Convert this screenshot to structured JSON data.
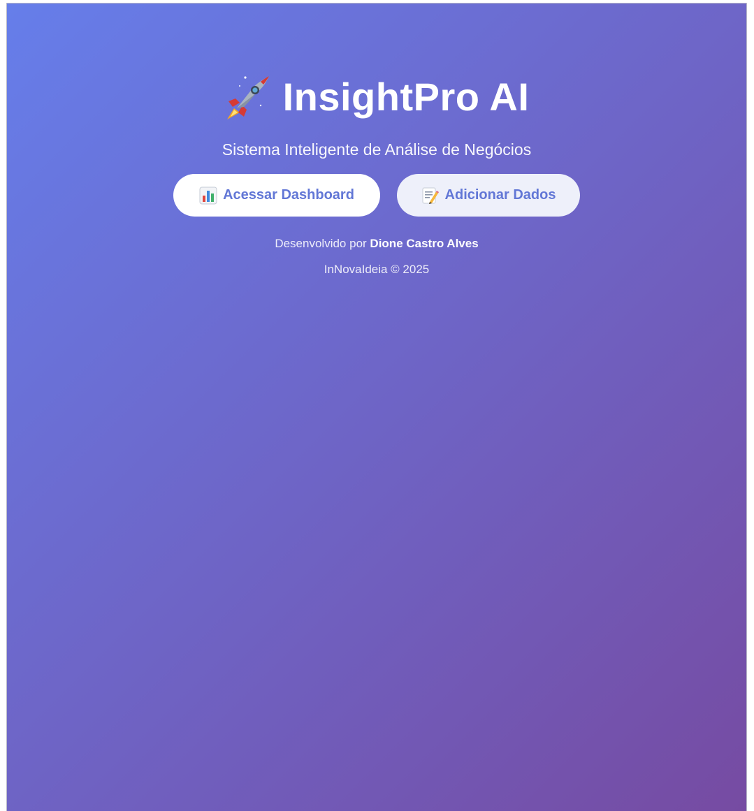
{
  "app": {
    "title": "InsightPro AI",
    "subtitle": "Sistema Inteligente de Análise de Negócios",
    "title_icon": "rocket-icon"
  },
  "actions": {
    "dashboard": {
      "label": "Acessar Dashboard",
      "icon": "bar-chart-icon"
    },
    "add_data": {
      "label": "Adicionar Dados",
      "icon": "memo-pencil-icon"
    }
  },
  "footer": {
    "developed_by_prefix": "Desenvolvido por",
    "developer_name": "Dione Castro Alves",
    "copyright": "InNovaIdeia © 2025"
  },
  "colors": {
    "gradient_start": "#667eea",
    "gradient_end": "#764ba2",
    "button_text": "#6277d6",
    "primary_button_bg": "#ffffff",
    "secondary_button_bg": "#eef0fa"
  }
}
